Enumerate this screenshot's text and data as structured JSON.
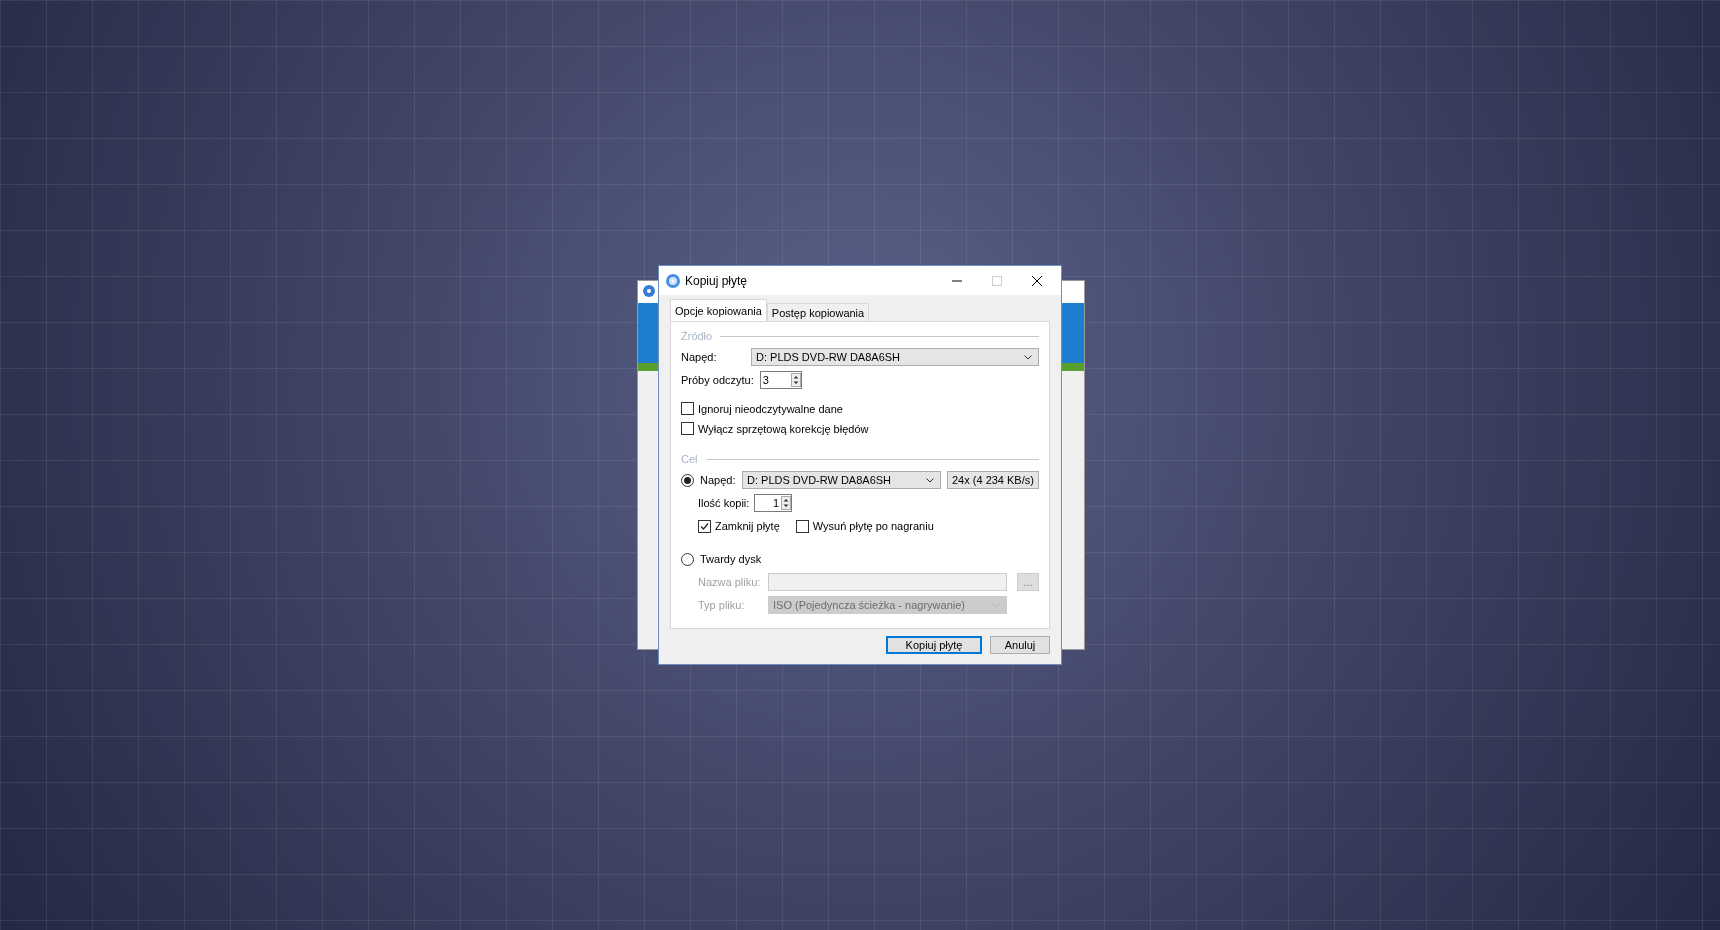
{
  "window": {
    "title": "Kopiuj płytę"
  },
  "tabs": [
    {
      "label": "Opcje kopiowania",
      "selected": true
    },
    {
      "label": "Postęp kopiowania",
      "selected": false
    }
  ],
  "source": {
    "heading": "Źródło",
    "drive_label": "Napęd:",
    "drive_value": "D: PLDS DVD-RW DA8A6SH",
    "retries_label": "Próby odczytu:",
    "retries_value": "3",
    "options": [
      {
        "label": "Ignoruj nieodczytywalne dane",
        "checked": false
      },
      {
        "label": "Wyłącz sprzętową korekcję błędów",
        "checked": false
      }
    ]
  },
  "target": {
    "heading": "Cel",
    "destinations": [
      {
        "kind": "drive",
        "label": "Napęd:",
        "selected": true,
        "drive_value": "D: PLDS DVD-RW DA8A6SH",
        "speed_value": "24x (4 234 KB/s)",
        "copies_label": "Ilość kopii:",
        "copies_value": "1",
        "options": [
          {
            "label": "Zamknij płytę",
            "checked": true
          },
          {
            "label": "Wysuń płytę po nagraniu",
            "checked": false
          }
        ]
      },
      {
        "kind": "disk",
        "label": "Twardy dysk",
        "selected": false,
        "disabled": true,
        "filename_label": "Nazwa pliku:",
        "browse_label": "...",
        "filetype_label": "Typ pliku:",
        "filetype_value": "ISO (Pojedyncza ścieżka - nagrywanie)"
      }
    ]
  },
  "buttons": [
    {
      "label": "Kopiuj płytę",
      "default": true
    },
    {
      "label": "Anuluj",
      "default": false
    }
  ]
}
